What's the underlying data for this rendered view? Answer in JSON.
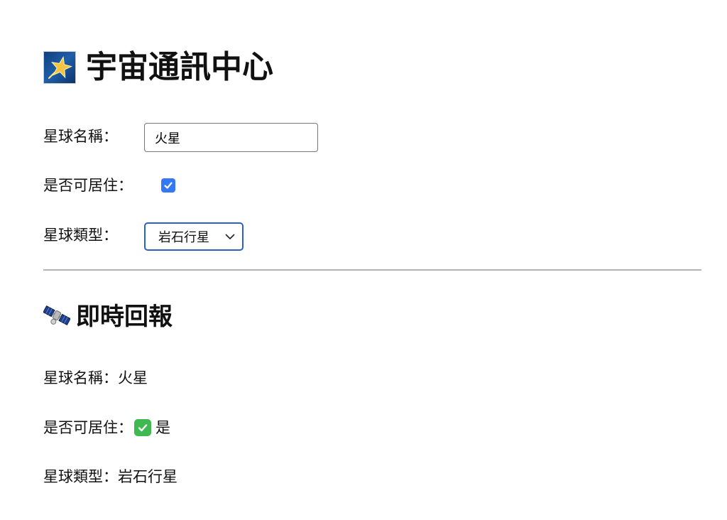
{
  "header": {
    "title": "宇宙通訊中心",
    "icon": "star-icon"
  },
  "form": {
    "planet_name_label": "星球名稱：",
    "planet_name_value": "火星",
    "habitable_label": "是否可居住：",
    "habitable_checked": true,
    "planet_type_label": "星球類型：",
    "planet_type_selected": "岩石行星"
  },
  "report": {
    "title": "即時回報",
    "icon": "satellite-icon",
    "name_label": "星球名稱：",
    "name_value": "火星",
    "habitable_label": "是否可居住：",
    "habitable_value": "是",
    "type_label": "星球類型：",
    "type_value": "岩石行星"
  },
  "colors": {
    "checkbox_accent": "#3378f6",
    "select_focus_border": "#2a60c8",
    "check_emoji": "#3fb950",
    "divider": "#b4b4b4"
  }
}
